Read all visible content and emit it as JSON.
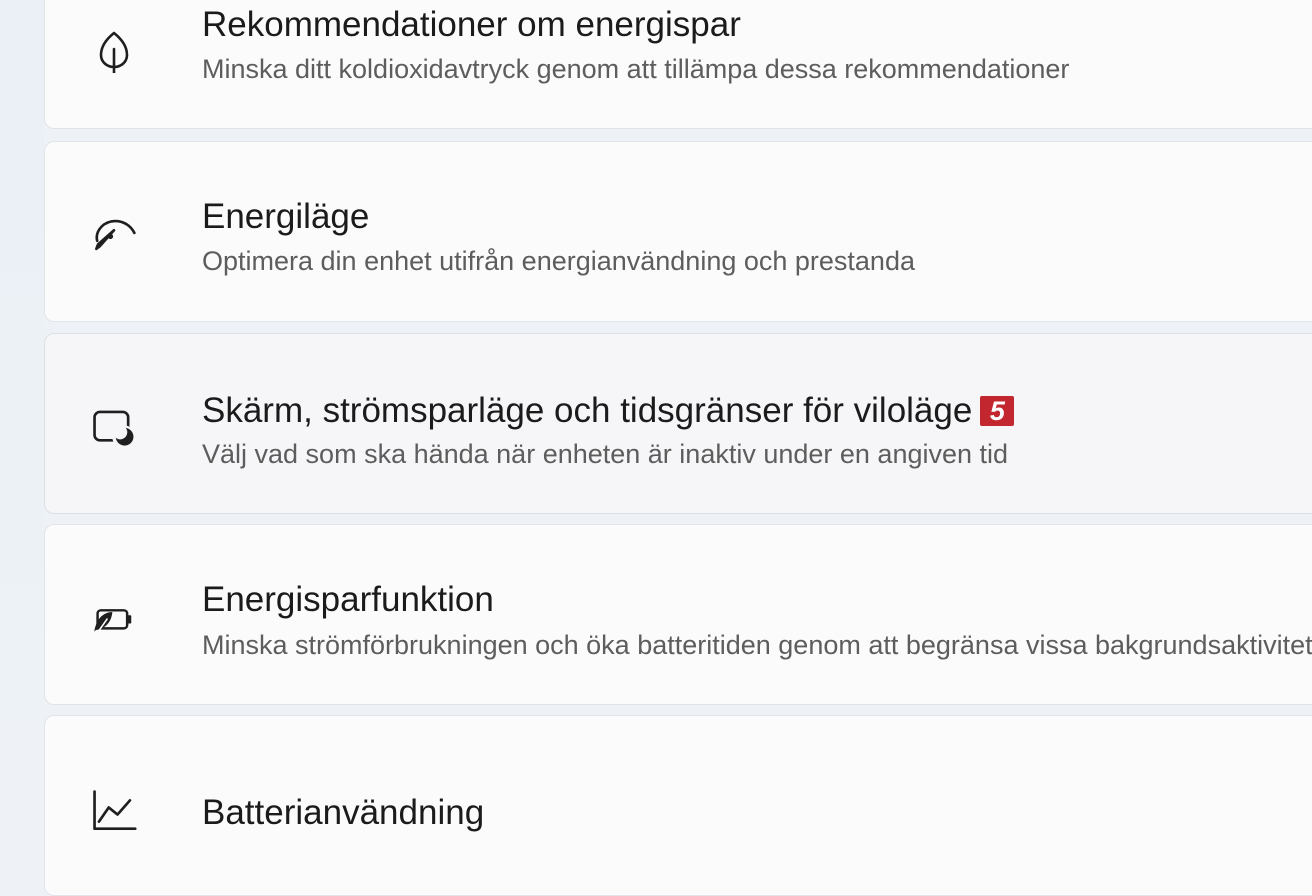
{
  "power_settings": {
    "items": [
      {
        "title": "Rekommendationer om energispar",
        "subtitle": "Minska ditt koldioxidavtryck genom att tillämpa dessa rekommendationer",
        "icon": "leaf-icon"
      },
      {
        "title": "Energiläge",
        "subtitle": "Optimera din enhet utifrån energianvändning och prestanda",
        "icon": "speedometer-icon"
      },
      {
        "title": "Skärm, strömsparläge och tidsgränser för viloläge",
        "subtitle": "Välj vad som ska hända när enheten är inaktiv under en angiven tid",
        "icon": "screen-sleep-icon",
        "badge": "5"
      },
      {
        "title": "Energisparfunktion",
        "subtitle": "Minska strömförbrukningen och öka batteritiden genom att begränsa vissa bakgrundsaktiviteter",
        "icon": "battery-saver-icon"
      },
      {
        "title": "Batterianvändning",
        "icon": "line-chart-icon"
      }
    ]
  },
  "colors": {
    "card_background": "#fbfbfc",
    "card_hover_background": "#f6f6f8",
    "badge_background": "#c2262e",
    "title_text": "#1b1b1b",
    "subtitle_text": "#5d5d5d"
  }
}
